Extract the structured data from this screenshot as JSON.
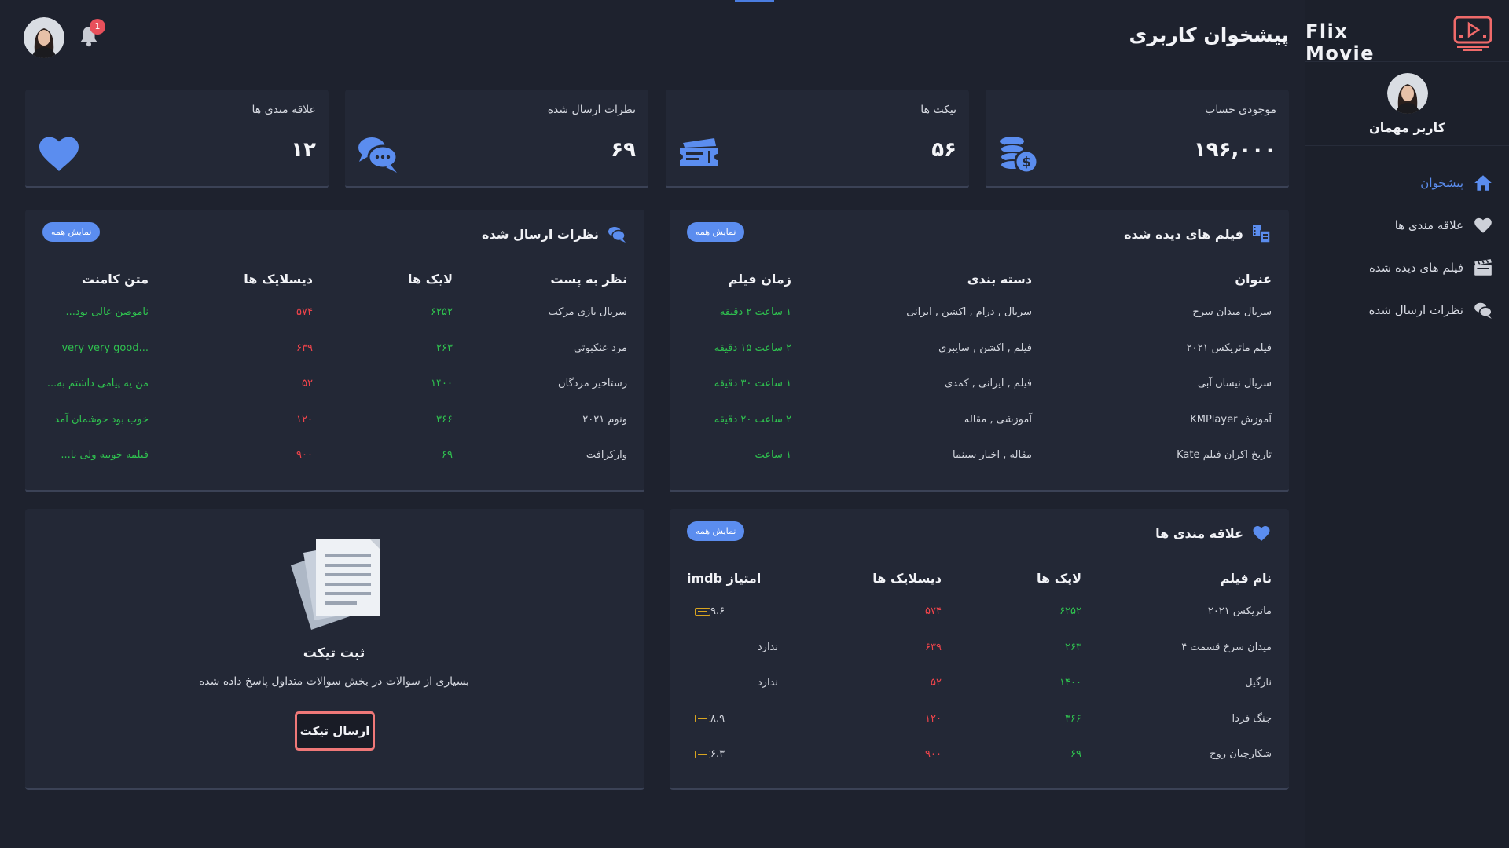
{
  "brand": {
    "name": "Flix Movie"
  },
  "user": {
    "name": "کاربر مهمان"
  },
  "header": {
    "title": "پیشخوان کاربری",
    "notification_count": "1"
  },
  "nav": [
    {
      "label": "پیشخوان",
      "icon": "home-icon",
      "active": true
    },
    {
      "label": "علاقه مندی ها",
      "icon": "heart-icon"
    },
    {
      "label": "فیلم های دیده شده",
      "icon": "clapperboard-icon"
    },
    {
      "label": "نظرات ارسال شده",
      "icon": "comments-icon"
    }
  ],
  "stats": [
    {
      "label": "موجودی حساب",
      "value": "۱۹۶,۰۰۰",
      "icon": "coins-icon"
    },
    {
      "label": "تیکت ها",
      "value": "۵۶",
      "icon": "ticket-icon"
    },
    {
      "label": "نظرات ارسال شده",
      "value": "۶۹",
      "icon": "comments-icon"
    },
    {
      "label": "علاقه مندی ها",
      "value": "۱۲",
      "icon": "heart-icon"
    }
  ],
  "show_all_label": "نمایش همه",
  "watched": {
    "title": "فیلم های دیده شده",
    "columns": [
      "عنوان",
      "دسته بندی",
      "زمان فیلم"
    ],
    "rows": [
      [
        "سریال میدان سرخ",
        "سریال , درام , اکشن , ایرانی",
        "۱ ساعت ۲ دقیقه"
      ],
      [
        "فیلم ماتریکس ۲۰۲۱",
        "فیلم , اکشن , سایبری",
        "۲ ساعت ۱۵ دقیقه"
      ],
      [
        "سریال نیسان آبی",
        "فیلم , ایرانی , کمدی",
        "۱ ساعت ۳۰ دقیقه"
      ],
      [
        "آموزش KMPlayer",
        "آموزشی , مقاله",
        "۲ ساعت ۲۰ دقیقه"
      ],
      [
        "تاریخ اکران فیلم Kate",
        "مقاله , اخبار سینما",
        "۱ ساعت"
      ]
    ]
  },
  "comments": {
    "title": "نظرات ارسال شده",
    "columns": [
      "نظر به پست",
      "لایک ها",
      "دیسلایک ها",
      "متن کامنت"
    ],
    "rows": [
      [
        "سریال بازی مرکب",
        "۶۲۵۲",
        "۵۷۴",
        "ناموصن عالی بود..."
      ],
      [
        "مرد عنکبوتی",
        "۲۶۳",
        "۶۳۹",
        "...very very good"
      ],
      [
        "رستاخیز مردگان",
        "۱۴۰۰",
        "۵۲",
        "من یه پیامی داشتم به..."
      ],
      [
        "ونوم ۲۰۲۱",
        "۳۶۶",
        "۱۲۰",
        "خوب بود خوشمان آمد"
      ],
      [
        "وارکرافت",
        "۶۹",
        "۹۰۰",
        "فیلمه خوبیه ولی با..."
      ]
    ]
  },
  "favorites": {
    "title": "علاقه مندی ها",
    "columns": [
      "نام فیلم",
      "لایک ها",
      "دیسلایک ها",
      "امتیاز imdb"
    ],
    "rows": [
      [
        "ماتریکس ۲۰۲۱",
        "۶۲۵۲",
        "۵۷۴",
        "۹.۶"
      ],
      [
        "میدان سرخ قسمت ۴",
        "۲۶۳",
        "۶۳۹",
        "ندارد"
      ],
      [
        "نارگیل",
        "۱۴۰۰",
        "۵۲",
        "ندارد"
      ],
      [
        "جنگ فردا",
        "۳۶۶",
        "۱۲۰",
        "۸.۹"
      ],
      [
        "شکارچیان روح",
        "۶۹",
        "۹۰۰",
        "۶.۳"
      ]
    ]
  },
  "ticket": {
    "title": "ثبت تیکت",
    "text": "بسیاری از سوالات در بخش سوالات متداول پاسخ داده شده",
    "button": "ارسال تیکت"
  },
  "colors": {
    "accent": "#5b8def",
    "positive": "#2fc24f",
    "negative": "#f0444b",
    "ticket_button_border": "#ef7878",
    "background": "#1e222e",
    "card": "#232836"
  }
}
